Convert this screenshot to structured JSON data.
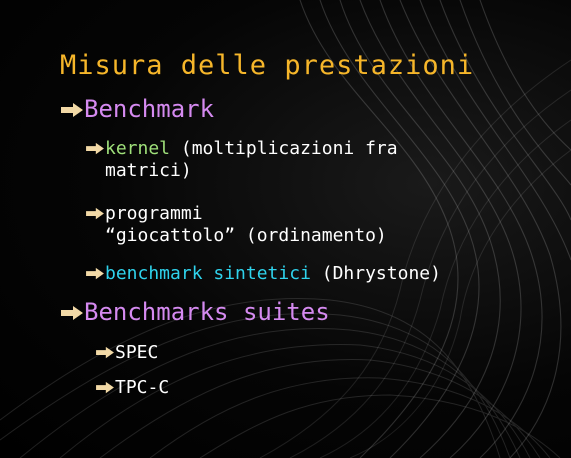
{
  "slide": {
    "title": "Misura delle prestazioni",
    "items": [
      {
        "label": "Benchmark",
        "children": [
          {
            "highlight": "kernel",
            "rest": " (moltiplicazioni fra",
            "line2": "matrici)"
          },
          {
            "text": "programmi",
            "line2": "“giocattolo” (ordinamento)"
          },
          {
            "highlight": "benchmark sintetici",
            "rest": " (Dhrystone)"
          }
        ]
      },
      {
        "label": "Benchmarks suites",
        "children": [
          {
            "text": "SPEC"
          },
          {
            "text": "TPC-C"
          }
        ]
      }
    ]
  },
  "colors": {
    "title": "#f6b62a",
    "level1": "#d58af0",
    "level2": "#ffffff",
    "highlight_kernel": "#9fe07a",
    "highlight_synthetic": "#2fd3ec",
    "bullet_arrow": "#f2d9a6",
    "background": "#000000"
  },
  "icons": {
    "bullet": "right-arrow-icon"
  }
}
